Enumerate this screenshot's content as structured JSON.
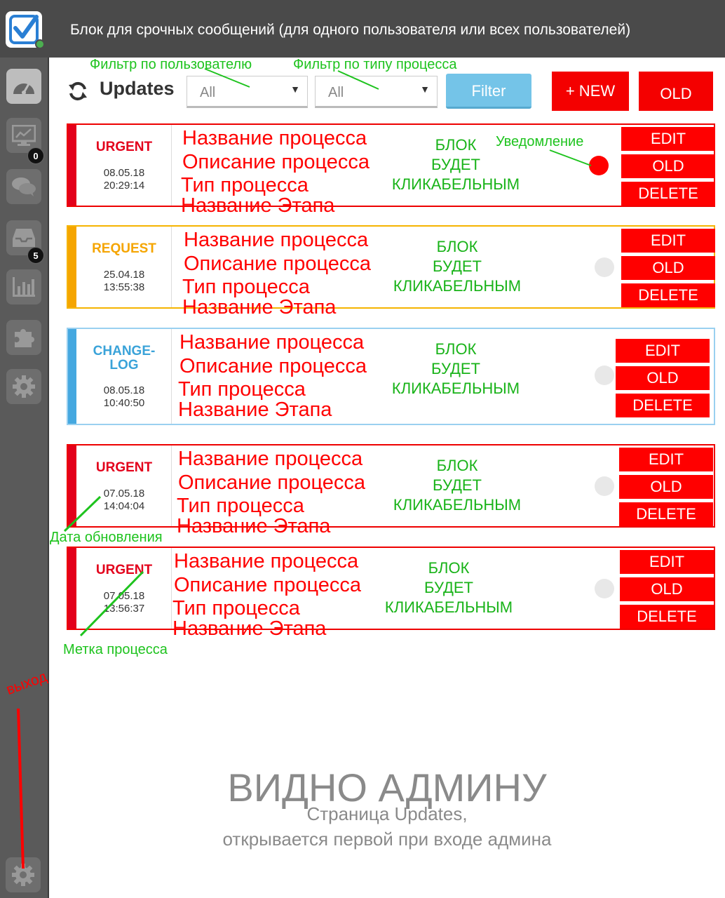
{
  "header": {
    "title": "Блок для срочных сообщений (для одного пользователя или всех пользователей)"
  },
  "sidebar": {
    "items": [
      {
        "icon": "dashboard-icon",
        "badge": ""
      },
      {
        "icon": "chart-monitor-icon",
        "badge": "0"
      },
      {
        "icon": "chat-icon",
        "badge": ""
      },
      {
        "icon": "inbox-icon",
        "badge": "5"
      },
      {
        "icon": "bar-chart-icon",
        "badge": ""
      },
      {
        "icon": "puzzle-icon",
        "badge": ""
      },
      {
        "icon": "gear-icon",
        "badge": ""
      }
    ],
    "bottom_icon": "gear-icon"
  },
  "toolbar": {
    "title": "Updates",
    "user_filter_value": "All",
    "type_filter_value": "All",
    "filter_label": "Filter",
    "new_label": "+ NEW",
    "old_label": "OLD"
  },
  "annotations": {
    "user_filter": "Фильтр по пользователю",
    "type_filter": "Фильтр по типу процесса",
    "notification": "Уведомление",
    "update_date": "Дата обновления",
    "process_tag": "Метка процесса",
    "exit": "выход"
  },
  "cards": [
    {
      "label": "URGENT",
      "label_color": "#e3001b",
      "stripe": "#e3001b",
      "date": "08.05.18",
      "time": "20:29:14",
      "name": "Название процесса",
      "description": "Описание процесса",
      "type": "Тип процесса",
      "stage": "Название Этапа",
      "note1": "БЛОК",
      "note2": "БУДЕТ",
      "note3": "КЛИКАБЕЛЬНЫМ",
      "notif_active": true,
      "edit": "EDIT",
      "old": "OLD",
      "delete": "DELETE"
    },
    {
      "label": "REQUEST",
      "label_color": "#f5a500",
      "stripe": "#f5a500",
      "date": "25.04.18",
      "time": "13:55:38",
      "name": "Название процесса",
      "description": "Описание процесса",
      "type": "Тип процесса",
      "stage": "Название Этапа",
      "note1": "БЛОК",
      "note2": "БУДЕТ",
      "note3": "КЛИКАБЕЛЬНЫМ",
      "notif_active": false,
      "edit": "EDIT",
      "old": "OLD",
      "delete": "DELETE"
    },
    {
      "label": "CHANGE-",
      "label2": "LOG",
      "label_color": "#3aa3d9",
      "stripe": "#45a8e0",
      "date": "08.05.18",
      "time": "10:40:50",
      "name": "Название процесса",
      "description": "Описание процесса",
      "type": "Тип процесса",
      "stage": "Название Этапа",
      "note1": "БЛОК",
      "note2": "БУДЕТ",
      "note3": "КЛИКАБЕЛЬНЫМ",
      "notif_active": false,
      "edit": "EDIT",
      "old": "OLD",
      "delete": "DELETE"
    },
    {
      "label": "URGENT",
      "label_color": "#e3001b",
      "stripe": "#e3001b",
      "date": "07.05.18",
      "time": "14:04:04",
      "name": "Название процесса",
      "description": "Описание процесса",
      "type": "Тип процесса",
      "stage": "Название Этапа",
      "note1": "БЛОК",
      "note2": "БУДЕТ",
      "note3": "КЛИКАБЕЛЬНЫМ",
      "notif_active": false,
      "edit": "EDIT",
      "old": "OLD",
      "delete": "DELETE"
    },
    {
      "label": "URGENT",
      "label_color": "#e3001b",
      "stripe": "#e3001b",
      "date": "07.05.18",
      "time": "13:56:37",
      "name": "Название процесса",
      "description": "Описание процесса",
      "type": "Тип процесса",
      "stage": "Название Этапа",
      "note1": "БЛОК",
      "note2": "БУДЕТ",
      "note3": "КЛИКАБЕЛЬНЫМ",
      "notif_active": false,
      "edit": "EDIT",
      "old": "OLD",
      "delete": "DELETE"
    }
  ],
  "footer": {
    "title": "ВИДНО АДМИНУ",
    "line1": "Страница Updates,",
    "line2": "открывается первой при входе админа"
  },
  "colors": {
    "header_bg": "#4a4a4a",
    "sidebar_bg": "#5a5a5a",
    "accent_red": "#f40000",
    "filter_blue": "#74c4e8",
    "annotation_green": "#1ec31e"
  }
}
